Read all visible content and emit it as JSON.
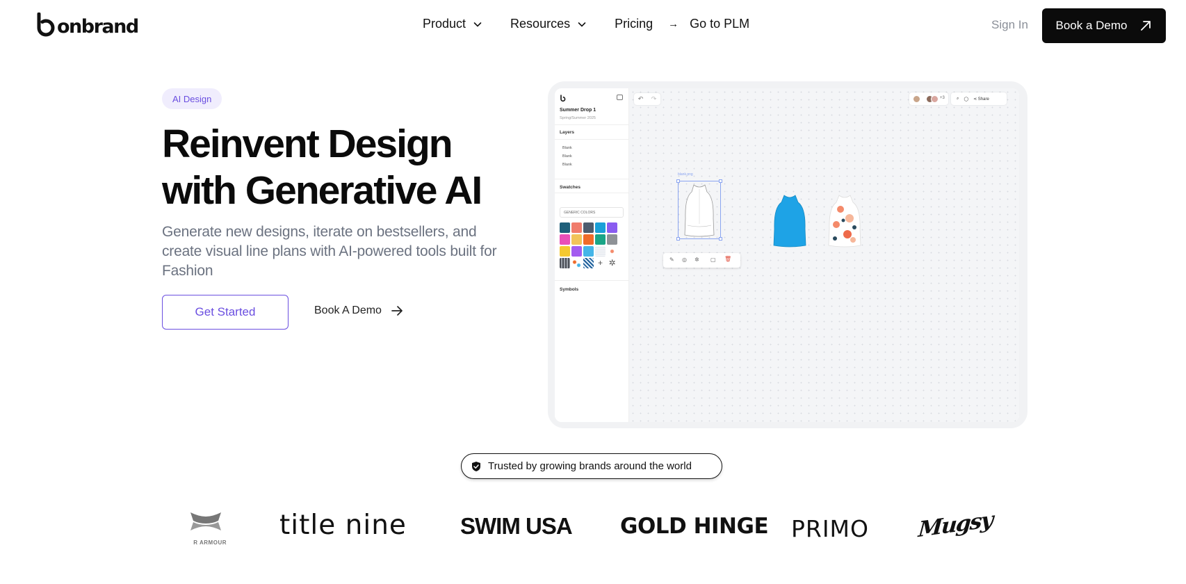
{
  "brand": {
    "name": "onbrand"
  },
  "nav": {
    "menu": [
      {
        "label": "Product",
        "has_dropdown": true
      },
      {
        "label": "Resources",
        "has_dropdown": true
      },
      {
        "label": "Pricing",
        "has_dropdown": false
      }
    ],
    "plm_label": "Go to PLM",
    "sign_in": "Sign In",
    "demo_cta": "Book a Demo"
  },
  "hero": {
    "badge": "AI Design",
    "title_line1": "Reinvent Design",
    "title_line2": "with Generative AI",
    "subtitle": "Generate new designs, iterate on bestsellers, and create visual line plans with AI-powered tools built for Fashion",
    "primary_cta": "Get Started",
    "secondary_cta": "Book A Demo",
    "accent_color": "#6a4ee0"
  },
  "app_preview": {
    "project_name": "Summer Drop 1",
    "season": "Spring/Summer 2025",
    "layers_heading": "Layers",
    "layers": [
      "Blank",
      "Blank",
      "Blank"
    ],
    "swatches_heading": "Swatches",
    "swatch_select": "GENERIC COLORS",
    "symbols_heading": "Symbols",
    "collaborators_extra": "+3",
    "share_label": "Share",
    "selection_label": "blank.png",
    "swatch_colors": [
      "#1f5f7a",
      "#f07c6c",
      "#4d5c6e",
      "#1aa0d8",
      "#8a5cf0",
      "#e94fb8",
      "#f2c45a",
      "#f06b2a",
      "#1aa587",
      "#8e9297",
      "#f5c930",
      "#a35cf0",
      "#45b5e8"
    ],
    "garment_colors": {
      "blank": "#ffffff",
      "solid": "#1ea3e6",
      "pattern": "#f48a6a"
    }
  },
  "trust": {
    "label": "Trusted by growing brands around the world",
    "brands": [
      {
        "name": "UNDER ARMOUR",
        "logo_text": "R ARMOUR"
      },
      {
        "name": "title nine"
      },
      {
        "name": "SWIM USA"
      },
      {
        "name": "GOLD HINGE"
      },
      {
        "name": "PRIMO"
      },
      {
        "name": "Mugsy"
      }
    ]
  }
}
